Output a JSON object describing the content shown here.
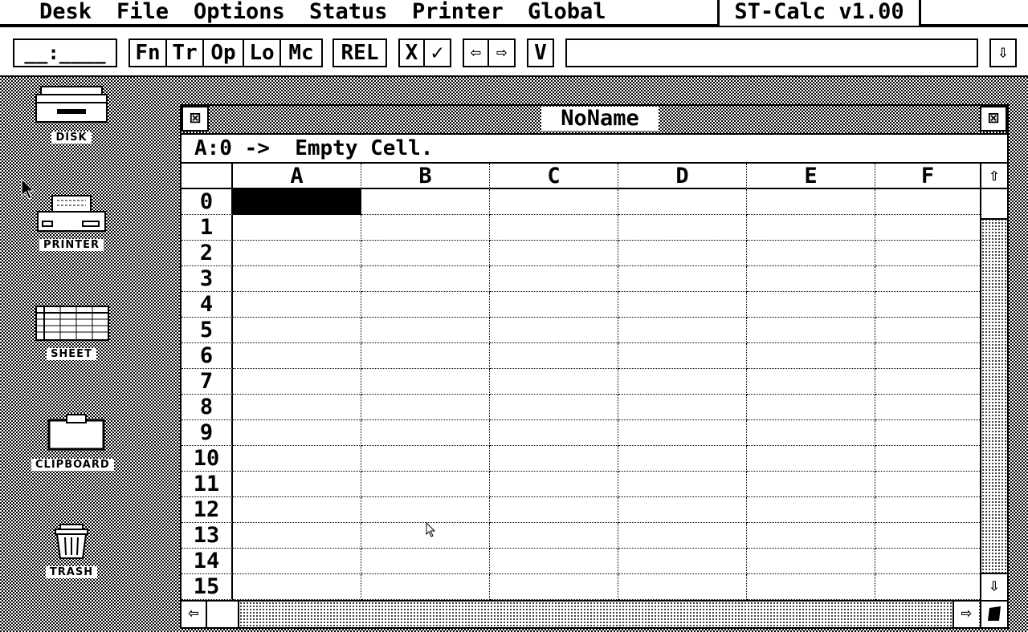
{
  "menubar": {
    "items": [
      "Desk",
      "File",
      "Options",
      "Status",
      "Printer",
      "Global"
    ],
    "app_title": "ST-Calc v1.00"
  },
  "toolbar": {
    "cell_ref_field": "__:____",
    "mode_buttons": [
      "Fn",
      "Tr",
      "Op",
      "Lo",
      "Mc"
    ],
    "rel_button": "REL",
    "cancel_button": "X",
    "confirm_button": "✓",
    "left_arrow": "⇦",
    "right_arrow": "⇨",
    "v_button": "V",
    "formula_input_value": "",
    "down_arrow": "⇩"
  },
  "desktop": {
    "icons": [
      "DISK",
      "PRINTER",
      "SHEET",
      "CLIPBOARD",
      "TRASH"
    ]
  },
  "window": {
    "title": "NoName",
    "close_glyph": "⊠",
    "full_glyph": "⊠",
    "status_line": "A:0 ->  Empty Cell.",
    "columns": [
      "A",
      "B",
      "C",
      "D",
      "E",
      "F"
    ],
    "rows": [
      "0",
      "1",
      "2",
      "3",
      "4",
      "5",
      "6",
      "7",
      "8",
      "9",
      "10",
      "11",
      "12",
      "13",
      "14",
      "15"
    ],
    "selected_cell": "A:0",
    "scroll_up": "⇧",
    "scroll_down": "⇩",
    "scroll_left": "⇦",
    "scroll_right": "⇨"
  }
}
